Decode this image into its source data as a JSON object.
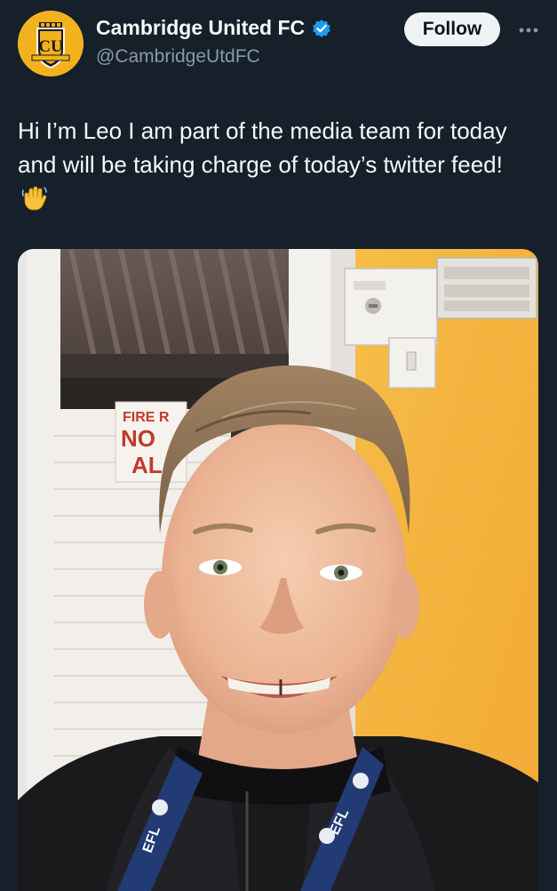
{
  "account": {
    "display_name": "Cambridge United FC",
    "handle": "@CambridgeUtdFC",
    "verified": true,
    "avatar_icon": "club-crest-icon",
    "avatar_text": "CU"
  },
  "actions": {
    "follow_label": "Follow",
    "more_icon": "more-dots-icon"
  },
  "tweet": {
    "text": "Hi I’m Leo I am part of the media team for today and will be taking charge of today’s twitter feed!",
    "emoji_icon": "waving-hand-icon"
  },
  "media": {
    "sign_line1": "FIRE R",
    "sign_line2": "NO",
    "sign_line3": "AL",
    "lanyard_text": "EFL"
  },
  "colors": {
    "background": "#15202b",
    "text_primary": "#f7f9f9",
    "text_secondary": "#8b98a5",
    "verified_blue": "#1d9bf0",
    "crest_yellow": "#f3b21d"
  }
}
